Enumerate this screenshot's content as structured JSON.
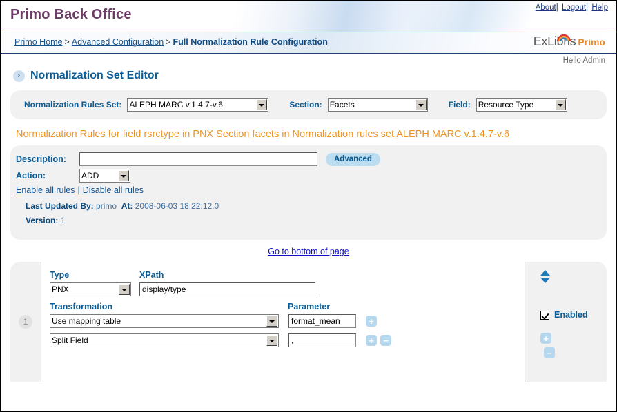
{
  "header": {
    "app_title": "Primo Back Office",
    "top_links": [
      {
        "label": "About"
      },
      {
        "label": "Logout"
      },
      {
        "label": "Help"
      }
    ],
    "separator": "|"
  },
  "breadcrumb": {
    "items": [
      {
        "label": "Primo Home",
        "link": true
      },
      {
        "label": "Advanced Configuration",
        "link": true
      },
      {
        "label": "Full Normalization Rule Configuration",
        "link": false
      }
    ],
    "separator": ">"
  },
  "logo": {
    "exlibris": "ExLibris",
    "primo": "Primo"
  },
  "greeting": "Hello Admin",
  "section": {
    "title": "Normalization Set Editor",
    "bullet_icon": "chevron-right-icon"
  },
  "selector_bar": {
    "rules_set_label": "Normalization Rules Set:",
    "rules_set_value": "ALEPH MARC v.1.4.7-v.6",
    "section_label": "Section:",
    "section_value": "Facets",
    "field_label": "Field:",
    "field_value": "Resource Type"
  },
  "orange_heading": {
    "part1": "Normalization Rules for field ",
    "field_link": "rsrctype",
    "part2": " in PNX Section ",
    "section_link": "facets",
    "part3": " in Normalization rules set ",
    "set_link": "ALEPH MARC v.1.4.7-v.6"
  },
  "description_panel": {
    "description_label": "Description:",
    "description_value": "",
    "description_placeholder": "",
    "advanced_button": "Advanced",
    "action_label": "Action:",
    "action_value": "ADD",
    "enable_all_link": "Enable all rules",
    "links_separator": "|",
    "disable_all_link": "Disable all rules",
    "last_updated_by_label": "Last Updated By:",
    "last_updated_by_value": "primo",
    "at_label": "At:",
    "at_value": "2008-06-03 18:22:12.0",
    "version_label": "Version:",
    "version_value": "1"
  },
  "goto_bottom_link": "Go to bottom of page",
  "rule": {
    "number": "1",
    "type_header": "Type",
    "xpath_header": "XPath",
    "type_value": "PNX",
    "xpath_value": "display/type",
    "transformation_header": "Transformation",
    "parameter_header": "Parameter",
    "transformations": [
      {
        "name": "Use mapping table",
        "parameter": "format_mean",
        "has_plus": true,
        "has_minus": false
      },
      {
        "name": "Split Field",
        "parameter": ",",
        "has_plus": true,
        "has_minus": true
      }
    ],
    "enabled_label": "Enabled",
    "enabled_checked": true,
    "move_up_icon": "triangle-up-icon",
    "move_down_icon": "triangle-down-icon",
    "add_icon": "plus-icon",
    "remove_icon": "minus-icon"
  },
  "colors": {
    "accent_blue": "#0a5d96",
    "link_blue": "#14528f",
    "orange": "#ef9321",
    "title_purple": "#6b3d67",
    "panel_gray": "#f1f1f1",
    "button_blue": "#b6d8ee"
  }
}
